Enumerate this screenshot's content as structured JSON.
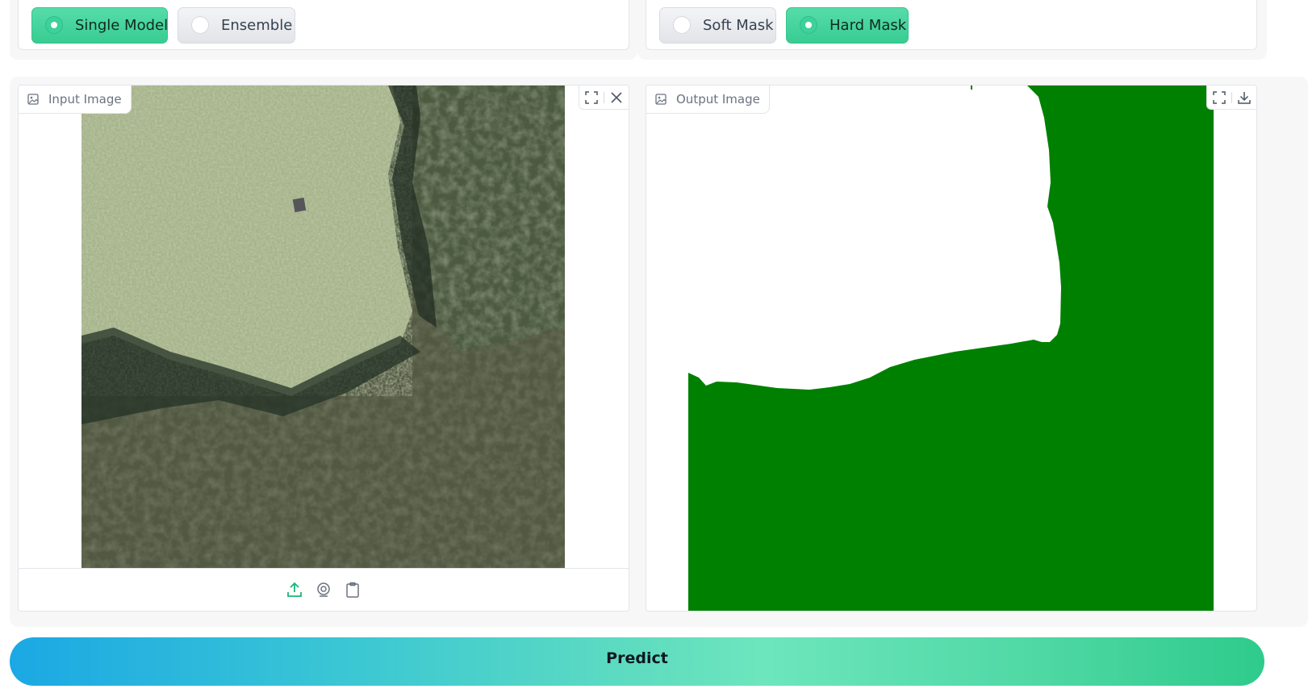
{
  "model_options": {
    "items": [
      {
        "label": "Single Model",
        "selected": true
      },
      {
        "label": "Ensemble",
        "selected": false
      }
    ]
  },
  "mask_options": {
    "items": [
      {
        "label": "Soft Mask",
        "selected": false
      },
      {
        "label": "Hard Mask",
        "selected": true
      }
    ]
  },
  "input_panel": {
    "label": "Input Image",
    "label_icon": "image-icon",
    "tools": [
      "fullscreen-icon",
      "close-icon"
    ],
    "sources": [
      "upload-icon",
      "webcam-icon",
      "clipboard-icon"
    ]
  },
  "output_panel": {
    "label": "Output Image",
    "label_icon": "image-icon",
    "tools": [
      "fullscreen-icon",
      "download-icon"
    ],
    "mask_color": "#008000"
  },
  "predict_button": {
    "label": "Predict"
  },
  "colors": {
    "accent": "#3ed19b",
    "mask_green": "#008000",
    "predict_gradient_start": "#1ba8e4",
    "predict_gradient_end": "#2ecb8c"
  }
}
